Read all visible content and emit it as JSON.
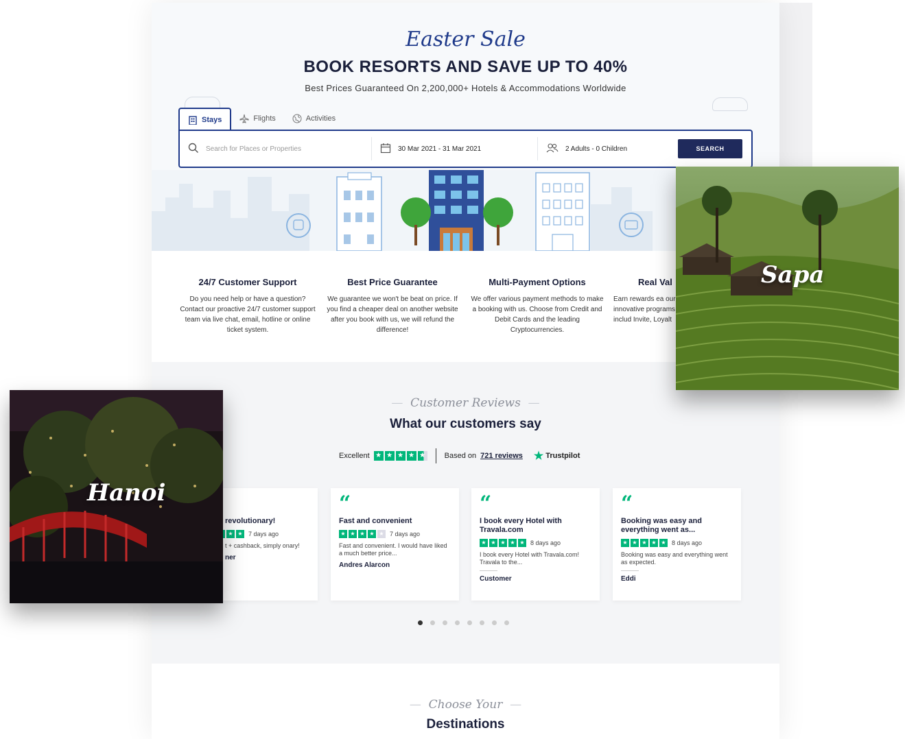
{
  "hero": {
    "script_title": "Easter Sale",
    "title": "BOOK RESORTS AND SAVE UP TO 40%",
    "subtitle": "Best Prices Guaranteed On 2,200,000+ Hotels & Accommodations Worldwide"
  },
  "tabs": [
    {
      "label": "Stays",
      "icon": "building-icon",
      "active": true
    },
    {
      "label": "Flights",
      "icon": "plane-icon",
      "active": false
    },
    {
      "label": "Activities",
      "icon": "globe-icon",
      "active": false
    }
  ],
  "search": {
    "placeholder": "Search for Places or Properties",
    "dates": "30 Mar 2021 - 31 Mar 2021",
    "guests": "2 Adults - 0 Children",
    "button": "SEARCH"
  },
  "features": [
    {
      "title": "24/7 Customer Support",
      "text": "Do you need help or have a question? Contact our proactive 24/7 customer support team via live chat, email, hotline or online ticket system."
    },
    {
      "title": "Best Price Guarantee",
      "text": "We guarantee we won't be beat on price. If you find a cheaper deal on another website after you book with us, we will refund the difference!"
    },
    {
      "title": "Multi-Payment Options",
      "text": "We offer various payment methods to make a booking with us. Choose from Credit and Debit Cards and the leading Cryptocurrencies."
    },
    {
      "title": "Real Val",
      "text": "Earn rewards ea our innovative programs includ Invite, Loyalt"
    }
  ],
  "reviews": {
    "script": "Customer Reviews",
    "title": "What our customers say",
    "excellent": "Excellent",
    "based_on": "Based on",
    "review_count": "721 reviews",
    "trustpilot": "Trustpilot",
    "cards": [
      {
        "title": "revolutionary!",
        "date": "7 days ago",
        "text": "t + cashback, simply onary!",
        "author": "ner"
      },
      {
        "title": "Fast and convenient",
        "date": "7 days ago",
        "text": "Fast and convenient. I would have liked a much better price...",
        "author": "Andres Alarcon"
      },
      {
        "title": "I book every Hotel with Travala.com",
        "date": "8 days ago",
        "text": "I book every Hotel with Travala.com! Travala to the...",
        "author": "Customer"
      },
      {
        "title": "Booking was easy and everything went as...",
        "date": "8 days ago",
        "text": "Booking was easy and everything went as expected.",
        "author": "Eddi"
      }
    ],
    "pager": {
      "total": 8,
      "active": 1
    }
  },
  "destinations": {
    "script": "Choose Your",
    "title": "Destinations"
  },
  "photos": {
    "hanoi": "Hanoi",
    "sapa": "Sapa"
  },
  "colors": {
    "brand": "#1f3a8a",
    "button": "#1f2a5c",
    "trustpilot": "#00b67a"
  }
}
